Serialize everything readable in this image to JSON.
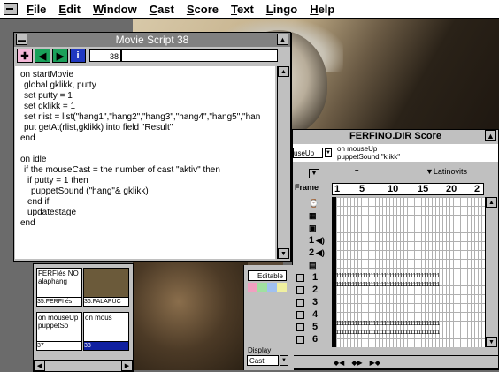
{
  "menubar": {
    "items": [
      "File",
      "Edit",
      "Window",
      "Cast",
      "Score",
      "Text",
      "Lingo",
      "Help"
    ]
  },
  "script_window": {
    "title": "Movie Script 38",
    "cast_number": "38",
    "toolbar_icons": [
      "plus-icon",
      "arrow-left-icon",
      "arrow-right-icon",
      "info-icon"
    ],
    "code": [
      "on startMovie",
      "  global gklikk, putty",
      "  set putty = 1",
      "  set gklikk = 1",
      "  set rlist = list(\"hang1\",\"hang2\",\"hang3\",\"hang4\",\"hang5\",\"han",
      "  put getAt(rlist,gklikk) into field \"Result\"",
      "end",
      "",
      "on idle",
      "  if the mouseCast = the number of cast \"aktiv\" then",
      "    if putty = 1 then",
      "      puppetSound (\"hang\"& gklikk)",
      "    end if",
      "    updatestage",
      "end"
    ]
  },
  "score_window": {
    "title": "FERFINO.DIR Score",
    "script_field_left": "useUp",
    "script_lines": [
      "on mouseUp",
      "puppetSound \"klikk\""
    ],
    "ink": "Latinovits",
    "frame_label": "Frame",
    "frame_numbers": [
      "1",
      "5",
      "10",
      "15",
      "20",
      "2"
    ],
    "channels": [
      "1",
      "2",
      "3",
      "4",
      "5",
      "6"
    ],
    "sound_channels": [
      "1",
      "2"
    ],
    "cell_values": "1111111111111111111111111111111111111111",
    "option_label": "Editable",
    "display_label": "Display",
    "display_value": "Cast"
  },
  "cast_window": {
    "cells": [
      {
        "text": "FERFIés NÖ alaphang",
        "label": "35:FERFI és"
      },
      {
        "text": "",
        "label": "36:FALAPÚC"
      },
      {
        "text": "on mouseUp puppetSo",
        "label": "37"
      },
      {
        "text": "on mous",
        "label": "38"
      }
    ]
  }
}
